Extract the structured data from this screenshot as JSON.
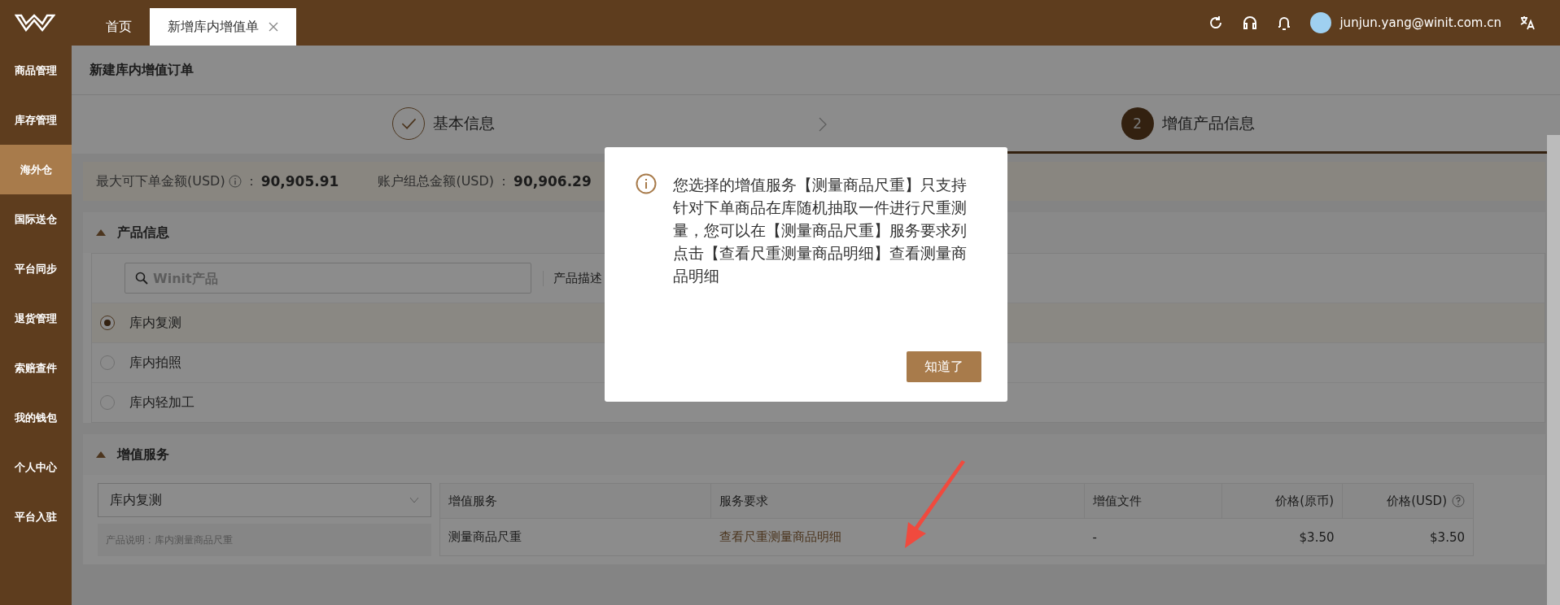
{
  "topbar": {
    "tabs": [
      {
        "label": "首页",
        "selected": false,
        "closable": false
      },
      {
        "label": "新增库内增值单",
        "selected": true,
        "closable": true
      }
    ],
    "user": "junjun.yang@winit.com.cn"
  },
  "sidebar": {
    "items": [
      {
        "label": "商品管理",
        "selected": false
      },
      {
        "label": "库存管理",
        "selected": false
      },
      {
        "label": "海外仓",
        "selected": true
      },
      {
        "label": "国际送仓",
        "selected": false
      },
      {
        "label": "平台同步",
        "selected": false
      },
      {
        "label": "退货管理",
        "selected": false
      },
      {
        "label": "索赔查件",
        "selected": false
      },
      {
        "label": "我的钱包",
        "selected": false
      },
      {
        "label": "个人中心",
        "selected": false
      },
      {
        "label": "平台入驻",
        "selected": false
      }
    ]
  },
  "page_title": "新建库内增值订单",
  "steps": [
    {
      "label": "基本信息",
      "done": true,
      "selected": false
    },
    {
      "label": "增值产品信息",
      "number": "2",
      "done": false,
      "selected": true
    }
  ],
  "balances": [
    {
      "label": "最大可下单金额(USD)",
      "info": true,
      "separator": "：",
      "value": "90,905.91"
    },
    {
      "label": "账户组总金额(USD)",
      "info": false,
      "separator": "：",
      "value": "90,906.29"
    }
  ],
  "product_section": {
    "title": "产品信息",
    "expanded": true,
    "search": {
      "placeholder": "Winit产品"
    },
    "column_label": "产品描述",
    "options": [
      {
        "label": "库内复测",
        "selected": true
      },
      {
        "label": "库内拍照",
        "selected": false
      },
      {
        "label": "库内轻加工",
        "selected": false
      }
    ]
  },
  "service_section": {
    "title": "增值服务",
    "expanded": true,
    "dropdown": {
      "value": "库内复测"
    },
    "note": "产品说明 : 库内测量商品尺重",
    "table": {
      "columns": [
        {
          "label": "增值服务",
          "help": false
        },
        {
          "label": "服务要求",
          "help": false
        },
        {
          "label": "增值文件",
          "help": false
        },
        {
          "label": "价格(原币)",
          "help": false
        },
        {
          "label": "价格(USD)",
          "help": true
        }
      ],
      "rows": [
        [
          {
            "kind": "text",
            "text": "测量商品尺重"
          },
          {
            "kind": "link",
            "text": "查看尺重测量商品明细"
          },
          {
            "kind": "text",
            "text": "-"
          },
          {
            "kind": "text",
            "text": "$3.50"
          },
          {
            "kind": "text",
            "text": "$3.50"
          }
        ]
      ]
    }
  },
  "dialog": {
    "message": "您选择的增值服务【测量商品尺重】只支持针对下单商品在库随机抽取一件进行尺重测量，您可以在【测量商品尺重】服务要求列点击【查看尺重测量商品明细】查看测量商品明细",
    "button": "知道了"
  }
}
